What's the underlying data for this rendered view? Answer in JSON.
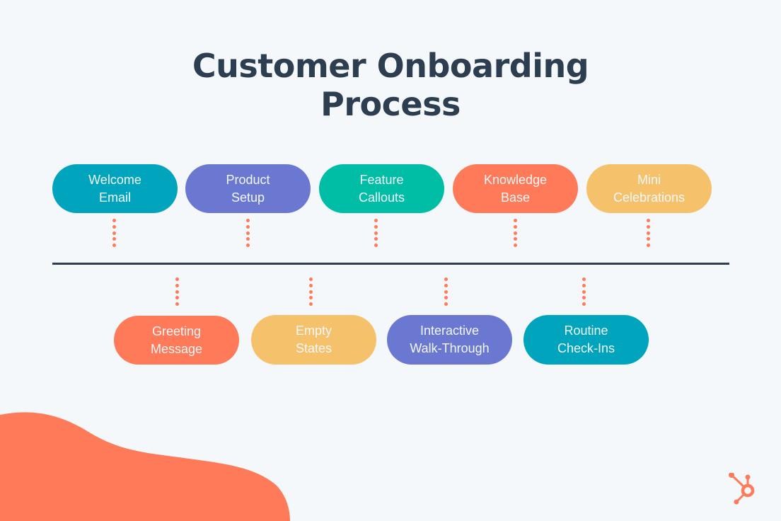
{
  "title": {
    "line1": "Customer Onboarding",
    "line2": "Process"
  },
  "colors": {
    "background": "#f4f8fb",
    "title": "#2d3e50",
    "timeline": "#2d3e50",
    "connector_dots": "#ff7a59",
    "teal_blue": "#00a4bd",
    "purple": "#6a78d1",
    "green": "#00bda5",
    "orange": "#ff7a59",
    "yellow": "#f5c26b"
  },
  "top_steps": [
    {
      "line1": "Welcome",
      "line2": "Email",
      "color": "#00a4bd"
    },
    {
      "line1": "Product",
      "line2": "Setup",
      "color": "#6a78d1"
    },
    {
      "line1": "Feature",
      "line2": "Callouts",
      "color": "#00bda5"
    },
    {
      "line1": "Knowledge",
      "line2": "Base",
      "color": "#ff7a59"
    },
    {
      "line1": "Mini",
      "line2": "Celebrations",
      "color": "#f5c26b"
    }
  ],
  "bottom_steps": [
    {
      "line1": "Greeting",
      "line2": "Message",
      "color": "#ff7a59"
    },
    {
      "line1": "Empty",
      "line2": "States",
      "color": "#f5c26b"
    },
    {
      "line1": "Interactive",
      "line2": "Walk-Through",
      "color": "#6a78d1"
    },
    {
      "line1": "Routine",
      "line2": "Check-Ins",
      "color": "#00a4bd"
    }
  ],
  "logo": {
    "icon": "hubspot-sprocket-icon",
    "color": "#ff7a59"
  },
  "decoration": {
    "icon": "orange-blob",
    "color": "#ff7a59"
  }
}
